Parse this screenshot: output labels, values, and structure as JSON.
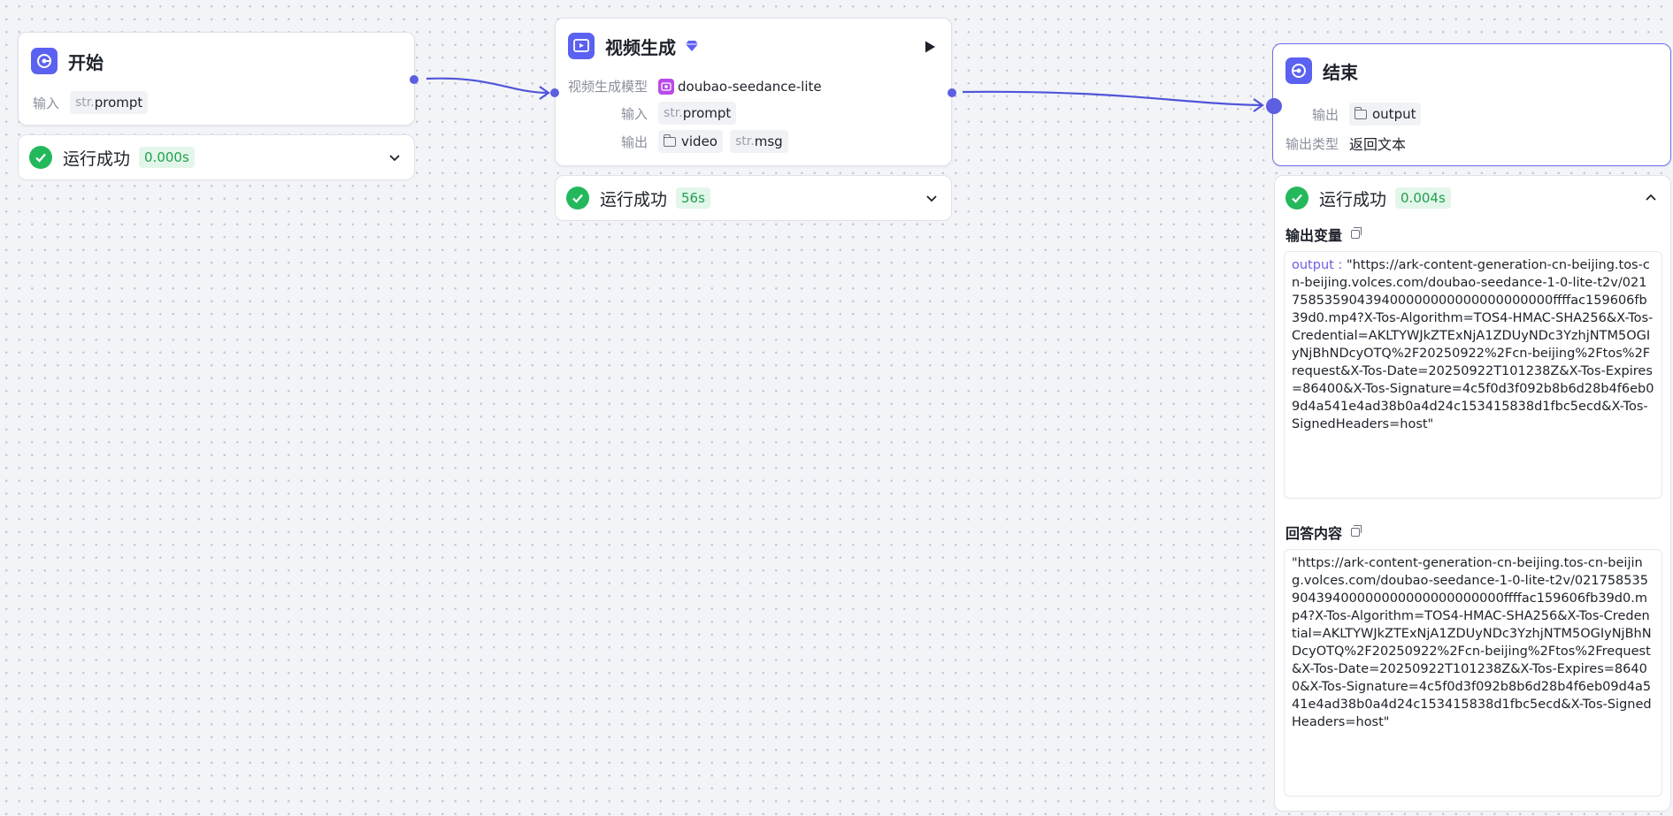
{
  "start_node": {
    "title": "开始",
    "input_label": "输入",
    "input_param": {
      "type": "str.",
      "name": "prompt"
    },
    "status": {
      "text": "运行成功",
      "time": "0.000s"
    }
  },
  "video_node": {
    "title": "视频生成",
    "model_label": "视频生成模型",
    "model_name": "doubao-seedance-lite",
    "input_label": "输入",
    "input_param": {
      "type": "str.",
      "name": "prompt"
    },
    "output_label": "输出",
    "outputs": [
      {
        "type": "",
        "name": "video",
        "icon": "folder-icon"
      },
      {
        "type": "str.",
        "name": "msg"
      }
    ],
    "status": {
      "text": "运行成功",
      "time": "56s"
    }
  },
  "end_node": {
    "title": "结束",
    "output_label": "输出",
    "output_param": {
      "name": "output",
      "icon": "folder-icon"
    },
    "output_type_label": "输出类型",
    "output_type_value": "返回文本",
    "status": {
      "text": "运行成功",
      "time": "0.004s"
    },
    "output_vars_title": "输出变量",
    "output_key": "output :",
    "output_value": "\"https://ark-content-generation-cn-beijing.tos-cn-beijing.volces.com/doubao-seedance-1-0-lite-t2v/02175853590439400000000000000000000ffffac159606fb39d0.mp4?X-Tos-Algorithm=TOS4-HMAC-SHA256&X-Tos-Credential=AKLTYWJkZTExNjA1ZDUyNDc3YzhjNTM5OGIyNjBhNDcyOTQ%2F20250922%2Fcn-beijing%2Ftos%2Frequest&X-Tos-Date=20250922T101238Z&X-Tos-Expires=86400&X-Tos-Signature=4c5f0d3f092b8b6d28b4f6eb09d4a541e4ad38b0a4d24c153415838d1fbc5ecd&X-Tos-SignedHeaders=host\"",
    "answer_title": "回答内容",
    "answer_value": "\"https://ark-content-generation-cn-beijing.tos-cn-beijing.volces.com/doubao-seedance-1-0-lite-t2v/02175853590439400000000000000000000ffffac159606fb39d0.mp4?X-Tos-Algorithm=TOS4-HMAC-SHA256&X-Tos-Credential=AKLTYWJkZTExNjA1ZDUyNDc3YzhjNTM5OGIyNjBhNDcyOTQ%2F20250922%2Fcn-beijing%2Ftos%2Frequest&X-Tos-Date=20250922T101238Z&X-Tos-Expires=86400&X-Tos-Signature=4c5f0d3f092b8b6d28b4f6eb09d4a541e4ad38b0a4d24c153415838d1fbc5ecd&X-Tos-SignedHeaders=host\""
  },
  "colors": {
    "accent": "#5b61f0",
    "edge": "#4f55d9",
    "success": "#24b85c",
    "success_bg": "#e3f6ea",
    "selected_border": "#6a6fe6"
  }
}
